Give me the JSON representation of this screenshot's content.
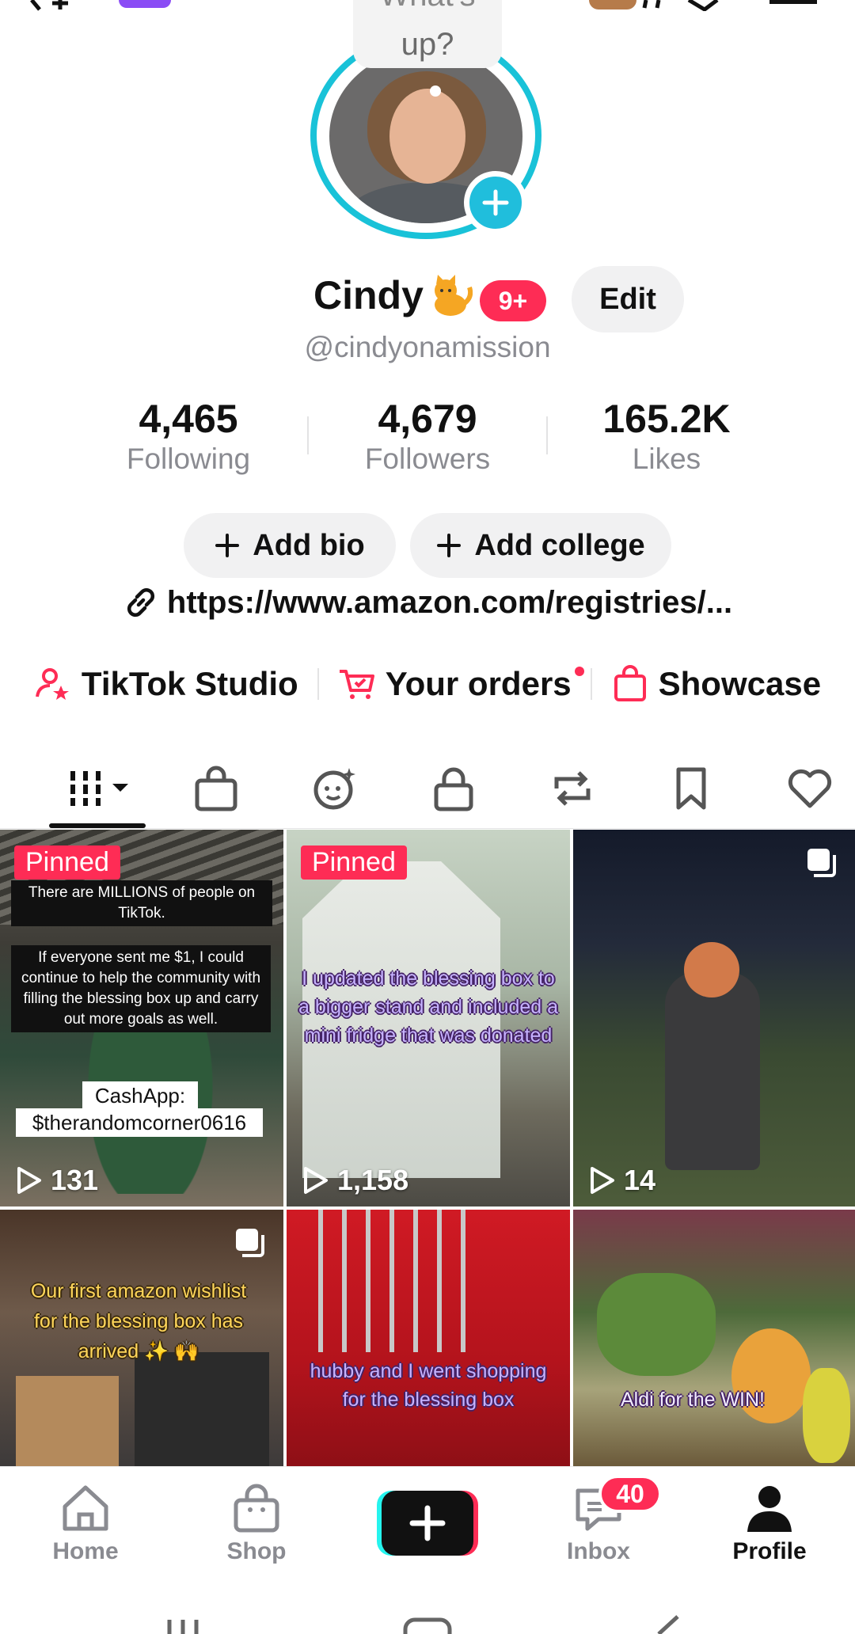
{
  "status_bubble": {
    "line1": "What's",
    "line2": "up?"
  },
  "profile": {
    "name": "Cindy",
    "name_emoji": "cat-emoji",
    "notification_badge": "9+",
    "edit_label": "Edit",
    "handle": "@cindyonamission"
  },
  "stats": [
    {
      "value": "4,465",
      "label": "Following"
    },
    {
      "value": "4,679",
      "label": "Followers"
    },
    {
      "value": "165.2K",
      "label": "Likes"
    }
  ],
  "actions": {
    "add_bio": "Add bio",
    "add_college": "Add college"
  },
  "link": "https://www.amazon.com/registries/...",
  "tools": [
    {
      "label": "TikTok Studio",
      "icon": "studio-icon"
    },
    {
      "label": "Your orders",
      "icon": "cart-icon",
      "has_dot": true
    },
    {
      "label": "Showcase",
      "icon": "bag-icon"
    }
  ],
  "tabs": [
    "videos-grid-icon",
    "shop-bag-icon",
    "ai-face-icon",
    "lock-icon",
    "repost-icon",
    "bookmark-icon",
    "heart-icon"
  ],
  "videos": [
    {
      "pinned": "Pinned",
      "views": "131",
      "caption1": "There are MILLIONS of people on TikTok.",
      "caption2": "If everyone sent me $1, I could continue to help the community with filling the blessing box up and carry out more goals as well.",
      "cash1": "CashApp:",
      "cash2": "$therandomcorner0616"
    },
    {
      "pinned": "Pinned",
      "views": "1,158",
      "caption": "I updated the blessing box to a bigger stand and included a mini fridge that was donated"
    },
    {
      "views": "14"
    },
    {
      "caption": "Our first amazon wishlist for the blessing box has arrived ✨ 🙌"
    },
    {
      "caption": "hubby and I went shopping for the blessing box"
    },
    {
      "caption": "Aldi for the WIN!"
    }
  ],
  "nav": {
    "home": "Home",
    "shop": "Shop",
    "inbox": "Inbox",
    "inbox_badge": "40",
    "profile": "Profile"
  },
  "colors": {
    "accent": "#fe2c55",
    "cyan": "#19c2d8",
    "muted": "#8a8b91"
  }
}
